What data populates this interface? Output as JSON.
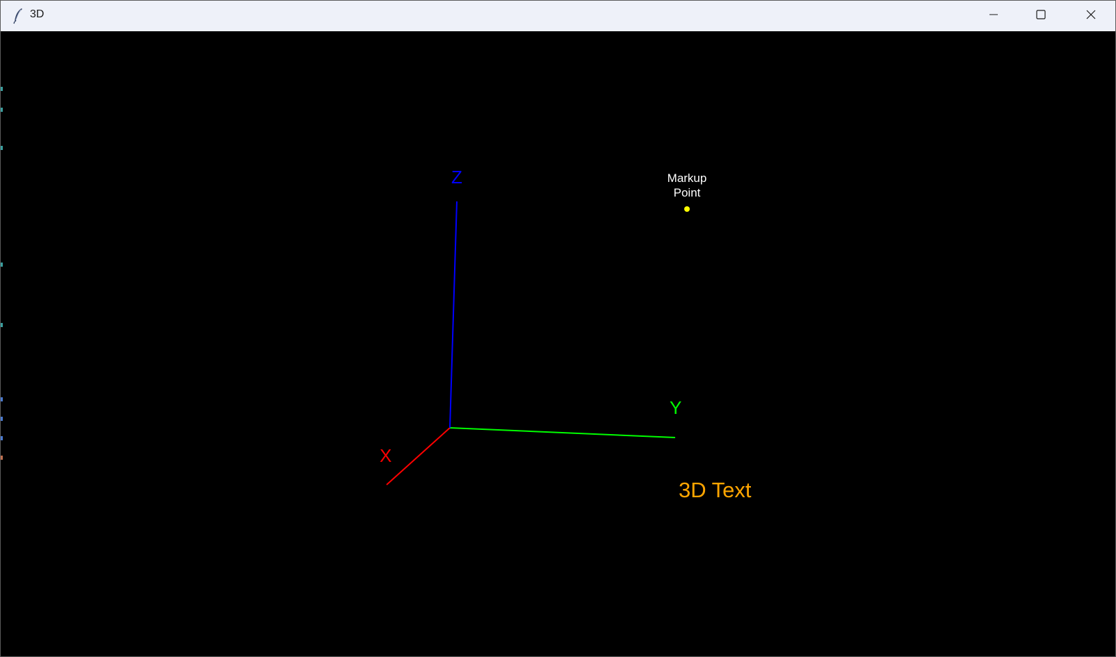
{
  "window": {
    "title": "3D",
    "app_icon": "feather-icon",
    "controls": {
      "minimize_icon": "minimize-icon",
      "maximize_icon": "maximize-icon",
      "close_icon": "close-icon"
    }
  },
  "scene": {
    "background_color": "#000000",
    "axes": {
      "x": {
        "label": "X",
        "color": "#ff0000"
      },
      "y": {
        "label": "Y",
        "color": "#00ff00"
      },
      "z": {
        "label": "Z",
        "color": "#0000ff"
      }
    },
    "markup_point": {
      "label_line1": "Markup",
      "label_line2": "Point",
      "color": "#ffff00",
      "label_color": "#ffffff"
    },
    "text_3d": {
      "text": "3D Text",
      "color": "#ffa500"
    }
  }
}
